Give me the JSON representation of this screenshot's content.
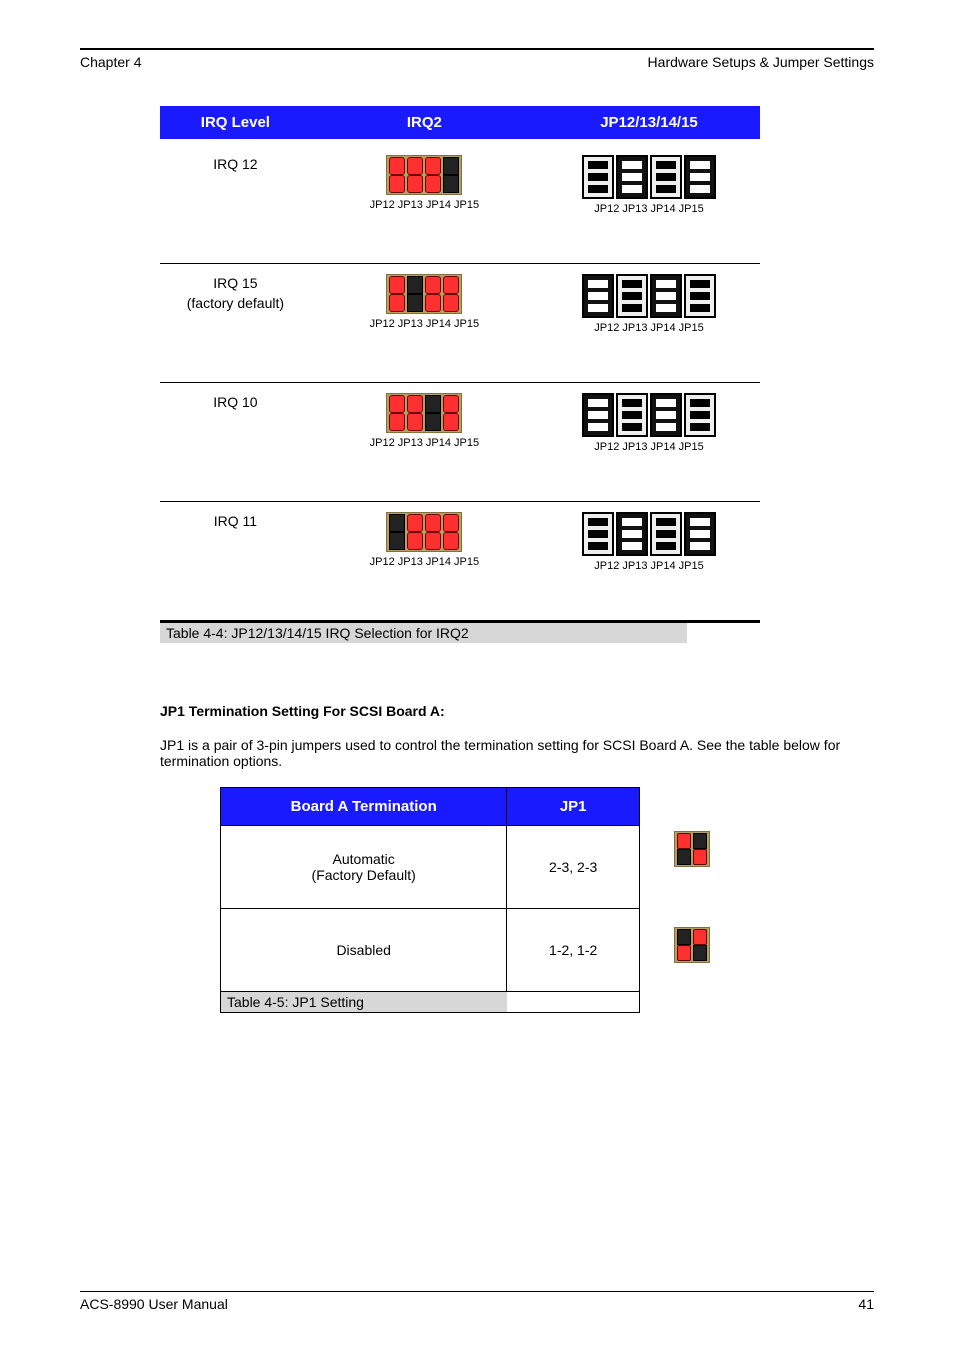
{
  "header": {
    "left": "Chapter 4",
    "right": "Hardware Setups & Jumper Settings"
  },
  "table1": {
    "head": {
      "c1": "IRQ Level",
      "c2": "IRQ2",
      "c3": "JP12/13/14/15"
    },
    "rows": [
      {
        "label": "IRQ 12",
        "jumper_short_col": 3,
        "dip_dark_cols": [
          0,
          2
        ],
        "sub": "JP12   JP13   JP14   JP15"
      },
      {
        "label": "IRQ 15\n(factory default)",
        "jumper_short_col": 1,
        "dip_dark_cols": [
          1,
          3
        ],
        "sub": "JP12   JP13   JP14   JP15"
      },
      {
        "label": "IRQ 10",
        "jumper_short_col": 2,
        "dip_dark_cols": [
          1,
          3
        ],
        "sub": "JP12   JP13   JP14   JP15"
      },
      {
        "label": "IRQ 11",
        "jumper_short_col": 0,
        "dip_dark_cols": [
          0,
          2
        ],
        "sub": "JP12   JP13   JP14   JP15"
      }
    ],
    "caption": "Table 4-4: JP12/13/14/15 IRQ Selection for IRQ2"
  },
  "section": {
    "note": "JP1 Termination Setting For SCSI Board A:",
    "body": "JP1 is a pair of 3-pin jumpers used to control the termination setting for SCSI Board A. See the table below for termination options."
  },
  "table2": {
    "head": {
      "c1": "Board A Termination",
      "c2": "JP1"
    },
    "rows": [
      {
        "c1": "Automatic\n(Factory Default)",
        "c2": "2-3, 2-3",
        "jumper": "auto"
      },
      {
        "c1": "Disabled",
        "c2": "1-2, 1-2",
        "jumper": "disabled"
      }
    ],
    "caption": "Table 4-5: JP1 Setting"
  },
  "footer": {
    "left": "ACS-8990 User Manual",
    "right": "41"
  }
}
